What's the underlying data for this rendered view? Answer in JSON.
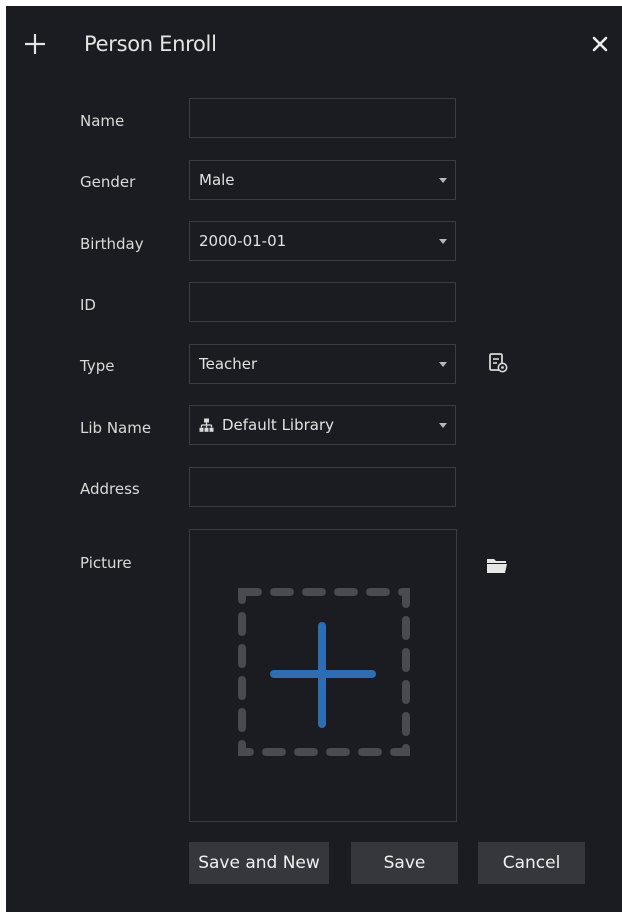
{
  "dialog": {
    "title": "Person Enroll",
    "icons": {
      "title": "plus-icon",
      "close": "close-icon"
    }
  },
  "form": {
    "name": {
      "label": "Name",
      "value": ""
    },
    "gender": {
      "label": "Gender",
      "value": "Male"
    },
    "birthday": {
      "label": "Birthday",
      "value": "2000-01-01"
    },
    "id": {
      "label": "ID",
      "value": ""
    },
    "type": {
      "label": "Type",
      "value": "Teacher",
      "side_icon": "type-settings-icon"
    },
    "lib_name": {
      "label": "Lib Name",
      "value": "Default Library",
      "icon": "org-tree-icon"
    },
    "address": {
      "label": "Address",
      "value": ""
    },
    "picture": {
      "label": "Picture",
      "side_icon": "folder-icon",
      "placeholder_icon": "add-picture-icon"
    }
  },
  "buttons": {
    "save_and_new": "Save and New",
    "save": "Save",
    "cancel": "Cancel"
  },
  "colors": {
    "background": "#1b1c21",
    "border": "#3b3d44",
    "button": "#35373d",
    "accent": "#2e6db4",
    "dashed": "#4a4b50"
  }
}
